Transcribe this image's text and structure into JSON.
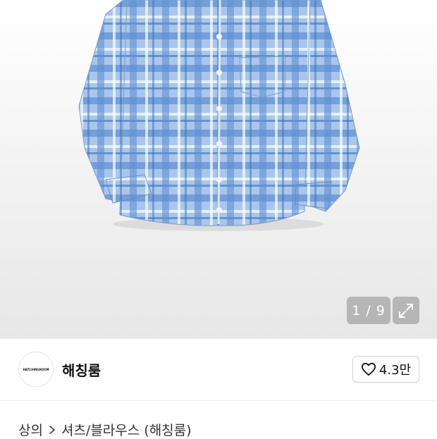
{
  "gallery": {
    "counter_text": "1 / 9",
    "expand_icon": "expand-icon",
    "background_color": "#eeeeee",
    "shirt_color": "#8db4e0"
  },
  "shop": {
    "logo_text": "HATCHINGROOM",
    "name": "해칭룸",
    "like_icon": "heart-outline-icon",
    "like_count": "4.3만"
  },
  "breadcrumb": {
    "items": [
      "상의",
      "셔츠/블라우스 (해칭룸)"
    ],
    "separator_icon": "chevron-right-icon"
  }
}
